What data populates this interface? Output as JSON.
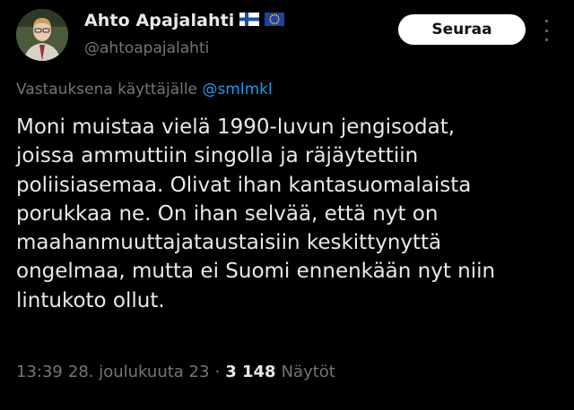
{
  "tweet": {
    "author_name": "Ahto Apajalahti",
    "author_handle": "@ahtoapajalahti",
    "follow_label": "Seuraa",
    "reply_prefix": "Vastauksena käyttäjälle",
    "reply_mention": "@smlmkl",
    "text": "Moni muistaa vielä 1990-luvun jengisodat,\njoissa ammuttiin singolla ja räjäytettiin\npoliisiasemaa. Olivat ihan kantasuomalaista\nporukkaa ne. On ihan selvää, että nyt on\nmaahanmuuttajataustaisiin keskittynyttä\nongelmaa, mutta ei Suomi ennenkään nyt niin\nlintukoto ollut.",
    "time": "13:39",
    "date": "28. joulukuuta 23",
    "separator": "·",
    "views_count": "3 148",
    "views_label": "Näytöt"
  },
  "icons": {
    "flags": [
      "finland-flag-icon",
      "eu-flag-icon"
    ],
    "more": "more-options-icon"
  },
  "colors": {
    "background": "#000000",
    "text": "#e7e9ea",
    "secondary": "#71767b",
    "accent": "#1d9bf0"
  }
}
